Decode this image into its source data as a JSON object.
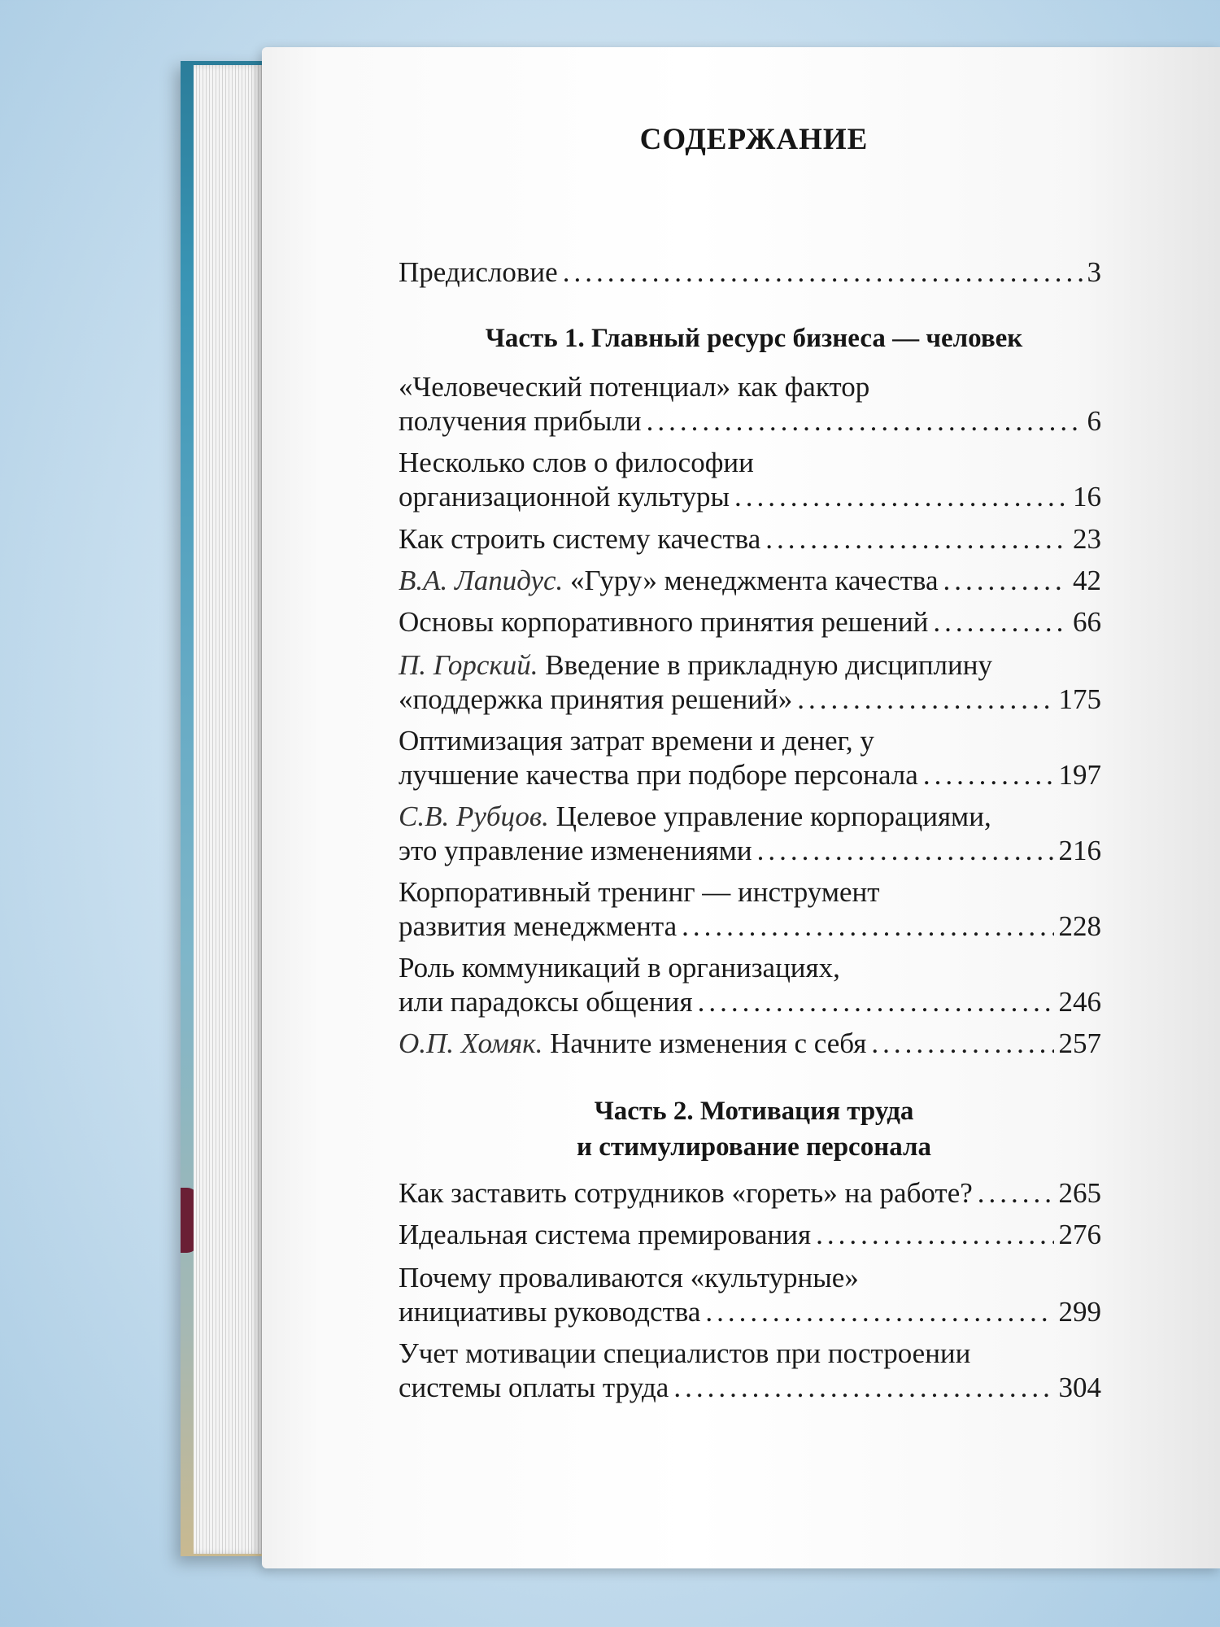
{
  "title": "СОДЕРЖАНИЕ",
  "preface": {
    "label": "Предисловие",
    "page": "3"
  },
  "part1": {
    "heading": "Часть 1. Главный ресурс бизнеса — человек",
    "items": [
      {
        "line1": "«Человеческий потенциал»  как фактор",
        "line2": "получения прибыли",
        "page": "6"
      },
      {
        "line1": "Несколько слов о философии",
        "line2": "организационной культуры",
        "page": "16"
      },
      {
        "line2": "Как строить систему качества",
        "page": "23"
      },
      {
        "author": "В.А. Лапидус.",
        "line2": "«Гуру» менеджмента качества",
        "page": "42"
      },
      {
        "line2": "Основы корпоративного принятия решений",
        "page": "66"
      },
      {
        "author": "П. Горский.",
        "line1": "Введение в прикладную дисциплину",
        "line2": "«поддержка принятия решений»",
        "page": "175"
      },
      {
        "line1": "Оптимизация затрат времени и денег, у",
        "line2": "лучшение качества при подборе персонала",
        "page": "197"
      },
      {
        "author": "С.В. Рубцов.",
        "line1": "Целевое управление корпорациями,",
        "line2": "это управление изменениями",
        "page": "216"
      },
      {
        "line1": "Корпоративный тренинг — инструмент",
        "line2": "развития менеджмента",
        "page": "228"
      },
      {
        "line1": "Роль коммуникаций в организациях,",
        "line2": "или парадоксы общения",
        "page": "246"
      },
      {
        "author": "О.П. Хомяк.",
        "line2": "Начните изменения с себя",
        "page": "257"
      }
    ]
  },
  "part2": {
    "heading_line1": "Часть 2. Мотивация труда",
    "heading_line2": "и стимулирование персонала",
    "items": [
      {
        "line2": "Как заставить сотрудников «гореть» на работе?",
        "page": "265"
      },
      {
        "line2": "Идеальная система премирования",
        "page": "276"
      },
      {
        "line1": "Почему проваливаются «культурные»",
        "line2": "инициативы руководства",
        "page": "299"
      },
      {
        "line1": "Учет мотивации специалистов при построении",
        "line2": "системы оплаты труда",
        "page": "304"
      }
    ]
  }
}
